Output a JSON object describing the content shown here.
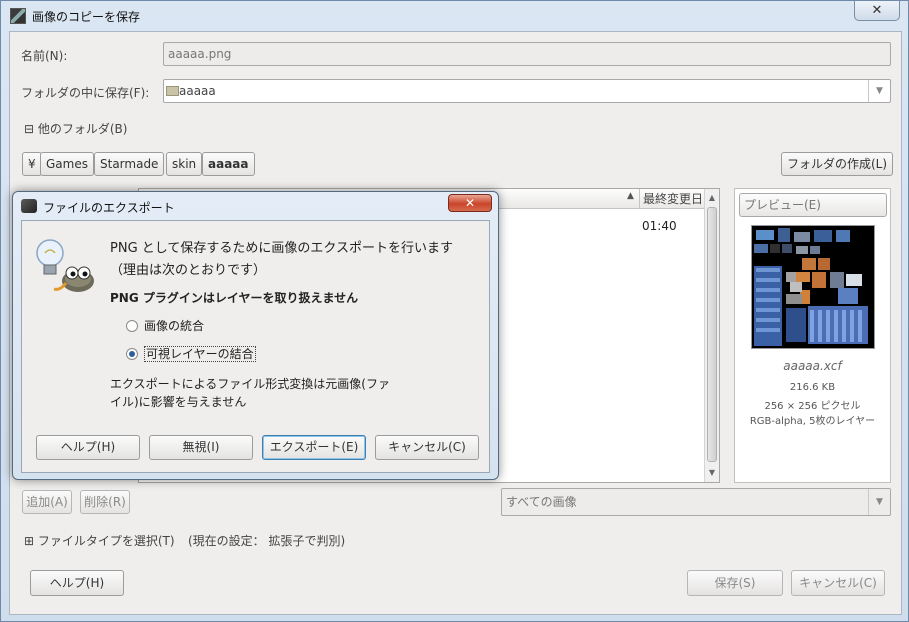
{
  "window": {
    "title": "画像のコピーを保存",
    "close_glyph": "✕"
  },
  "form": {
    "name_label": "名前(N):",
    "name_value": "aaaaa.png",
    "save_in_label": "フォルダの中に保存(F):",
    "save_in_value": "aaaaa",
    "other_folders": "⊟ 他のフォルダ(B)"
  },
  "path_bar": {
    "items": [
      "¥",
      "Games",
      "Starmade",
      "skin",
      "aaaaa"
    ],
    "create_folder": "フォルダの作成(L)"
  },
  "file_list": {
    "col_modified": "最終変更日",
    "sort_glyph": "▲",
    "row_time": "01:40"
  },
  "preview": {
    "label": "プレビュー(E)",
    "file_name": "aaaaa.xcf",
    "size": "216.6 KB",
    "dims": "256 × 256 ピクセル",
    "desc": "RGB-alpha, 5枚のレイヤー"
  },
  "list_buttons": {
    "add": "追加(A)",
    "remove": "削除(R)"
  },
  "filter": {
    "value": "すべての画像"
  },
  "file_type": {
    "expander": "⊞ ファイルタイプを選択(T)",
    "current": "(現在の設定： 拡張子で判別)"
  },
  "bottom": {
    "help": "ヘルプ(H)",
    "save": "保存(S)",
    "cancel": "キャンセル(C)"
  },
  "export_dialog": {
    "title": "ファイルのエクスポート",
    "close_glyph": "✕",
    "message_line1": "PNG として保存するために画像のエクスポートを行います",
    "message_line2": "（理由は次のとおりです）",
    "reason": "PNG プラグインはレイヤーを取り扱えません",
    "options": [
      "画像の統合",
      "可視レイヤーの結合"
    ],
    "selected_index": 1,
    "note_line1": "エクスポートによるファイル形式変換は元画像(ファ",
    "note_line2": "イル)に影響を与えません",
    "buttons": {
      "help": "ヘルプ(H)",
      "ignore": "無視(I)",
      "export": "エクスポート(E)",
      "cancel": "キャンセル(C)"
    }
  },
  "colors": {
    "titlebar": "#d5e1ef",
    "dialog_bg": "#efeeec",
    "close_red": "#c9452b",
    "focus_blue": "#3c7fb1"
  },
  "icons": {
    "folder": "folder-icon",
    "wilber": "gimp-wilber-icon",
    "lightbulb": "lightbulb-icon"
  }
}
